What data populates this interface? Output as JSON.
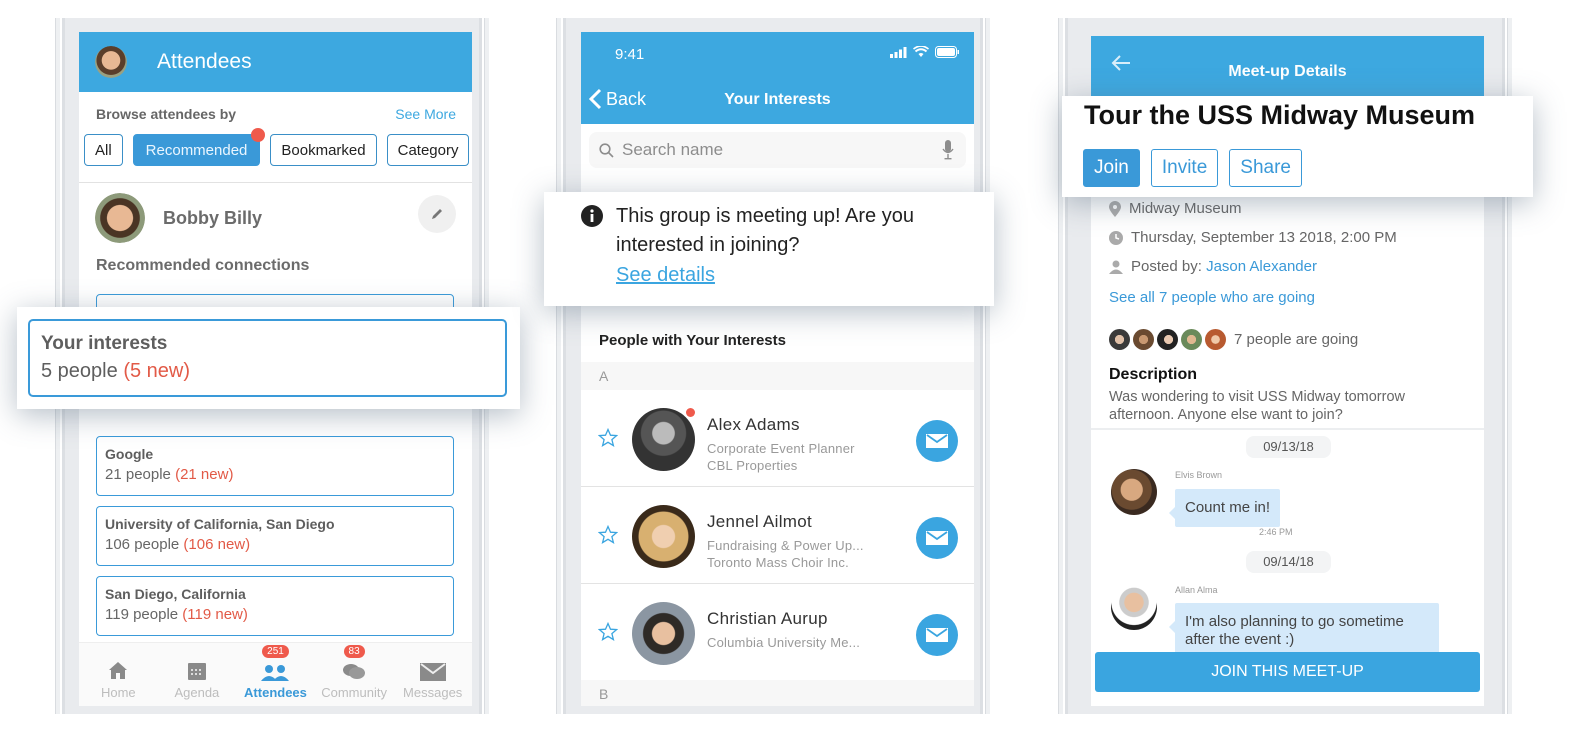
{
  "colors": {
    "accent": "#3da8e0",
    "badge": "#ef5a4c",
    "new_count": "#e25a47",
    "bubble": "#d4e9fa"
  },
  "attendees_screen": {
    "header_title": "Attendees",
    "browse_label": "Browse attendees by",
    "see_more": "See More",
    "filters": [
      {
        "label": "All",
        "active": false
      },
      {
        "label": "Recommended",
        "active": true,
        "has_dot": true
      },
      {
        "label": "Bookmarked",
        "active": false
      },
      {
        "label": "Category",
        "active": false
      }
    ],
    "profile_name": "Bobby Billy",
    "edit_icon": "pencil-icon",
    "recommended_label": "Recommended connections",
    "groups": [
      {
        "name": "Your interests",
        "count": "5 people",
        "new": "(5 new)"
      },
      {
        "name": "Google",
        "count": "21 people",
        "new": "(21 new)"
      },
      {
        "name": "University of California, San Diego",
        "count": "106 people",
        "new": "(106 new)"
      },
      {
        "name": "San Diego, California",
        "count": "119 people",
        "new": "(119 new)"
      }
    ],
    "tabs": [
      {
        "label": "Home",
        "icon": "home-icon"
      },
      {
        "label": "Agenda",
        "icon": "calendar-icon"
      },
      {
        "label": "Attendees",
        "icon": "people-icon",
        "badge": "251",
        "active": true
      },
      {
        "label": "Community",
        "icon": "chat-bubbles-icon",
        "badge": "83"
      },
      {
        "label": "Messages",
        "icon": "envelope-icon"
      }
    ],
    "callout": {
      "title": "Your interests",
      "count": "5 people",
      "new": "(5 new)"
    }
  },
  "interests_screen": {
    "status_time": "9:41",
    "back_label": "Back",
    "title": "Your Interests",
    "search_placeholder": "Search name",
    "callout": {
      "message": "This group is meeting up! Are you interested in joining?",
      "link": "See details"
    },
    "list_title": "People with Your Interests",
    "sections": [
      {
        "letter": "A",
        "people": [
          {
            "name": "Alex Adams",
            "title": "Corporate Event Planner",
            "org": "CBL Properties",
            "online": true
          },
          {
            "name": "Jennel Ailmot",
            "title": "Fundraising & Power Up...",
            "org": "Toronto Mass Choir Inc.",
            "online": false
          },
          {
            "name": "Christian Aurup",
            "title": "Columbia University Me...",
            "org": "",
            "online": false
          }
        ]
      },
      {
        "letter": "B",
        "people": []
      }
    ]
  },
  "meetup_screen": {
    "header_title": "Meet-up Details",
    "callout": {
      "title": "Tour the USS Midway Museum",
      "actions": [
        "Join",
        "Invite",
        "Share"
      ]
    },
    "location": "Midway Museum",
    "datetime": "Thursday, September 13 2018, 2:00 PM",
    "posted_by_label": "Posted by:",
    "posted_by_name": "Jason Alexander",
    "see_all_link": "See all 7 people who are going",
    "going_text": "7 people are going",
    "description_title": "Description",
    "description_body": "Was wondering to visit USS Midway tomorrow afternoon. Anyone else want to join?",
    "messages": [
      {
        "date": "09/13/18",
        "sender": "Elvis Brown",
        "text": "Count me in!",
        "time": "2:46 PM"
      },
      {
        "date": "09/14/18",
        "sender": "Allan Alma",
        "text": "I'm also planning to go sometime after the event :)",
        "time": ""
      }
    ],
    "join_button": "JOIN THIS MEET-UP"
  }
}
